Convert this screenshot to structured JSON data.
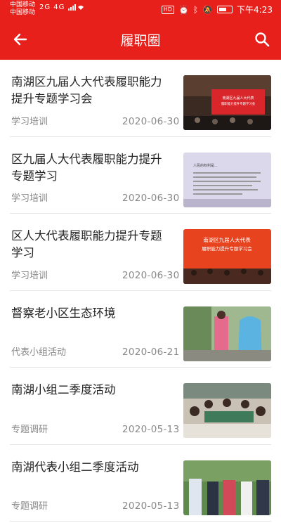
{
  "status_bar": {
    "carrier_1": "中国移动",
    "carrier_2": "中国移动",
    "signal": "2G 4G",
    "hd": "HD",
    "time": "下午4:23"
  },
  "header": {
    "title": "履职圈",
    "back_icon": "arrow-left-icon",
    "search_icon": "search-icon"
  },
  "colors": {
    "brand_red": "#e8201c",
    "text": "#222222",
    "meta": "#888888"
  },
  "items": [
    {
      "title": "南湖区九届人大代表履职能力提升专题学习会",
      "category": "学习培训",
      "date": "2020-06-30",
      "thumb_text_1": "南湖区九届人大代表",
      "thumb_text_2": "履职能力提升专题学习会"
    },
    {
      "title": "区九届人大代表履职能力提升专题学习",
      "category": "学习培训",
      "date": "2020-06-30",
      "thumb_text_1": "人民的权利是...",
      "thumb_text_2": ""
    },
    {
      "title": "区人大代表履职能力提升专题学习",
      "category": "学习培训",
      "date": "2020-06-30",
      "thumb_text_1": "南湖区九届人大代表",
      "thumb_text_2": "履职能力提升专题学习会"
    },
    {
      "title": "督察老小区生态环境",
      "category": "代表小组活动",
      "date": "2020-06-21"
    },
    {
      "title": "南湖小组二季度活动",
      "category": "专题调研",
      "date": "2020-05-13"
    },
    {
      "title": "南湖代表小组二季度活动",
      "category": "专题调研",
      "date": "2020-05-13"
    }
  ]
}
